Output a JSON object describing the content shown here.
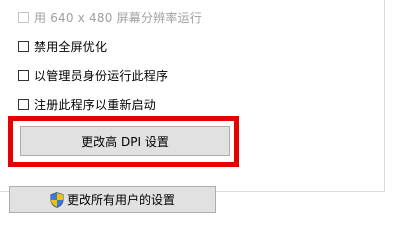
{
  "compatibility": {
    "options": [
      {
        "label": "用 640 x 480 屏幕分辨率运行",
        "checked": false,
        "disabled": true
      },
      {
        "label": "禁用全屏优化",
        "checked": false,
        "disabled": false
      },
      {
        "label": "以管理员身份运行此程序",
        "checked": false,
        "disabled": false
      },
      {
        "label": "注册此程序以重新启动",
        "checked": false,
        "disabled": false
      }
    ],
    "change_dpi_button": "更改高 DPI 设置",
    "all_users_button": "更改所有用户的设置",
    "highlight_color": "#e60000"
  },
  "icons": {
    "all_users_button_icon": "uac-shield-icon"
  }
}
